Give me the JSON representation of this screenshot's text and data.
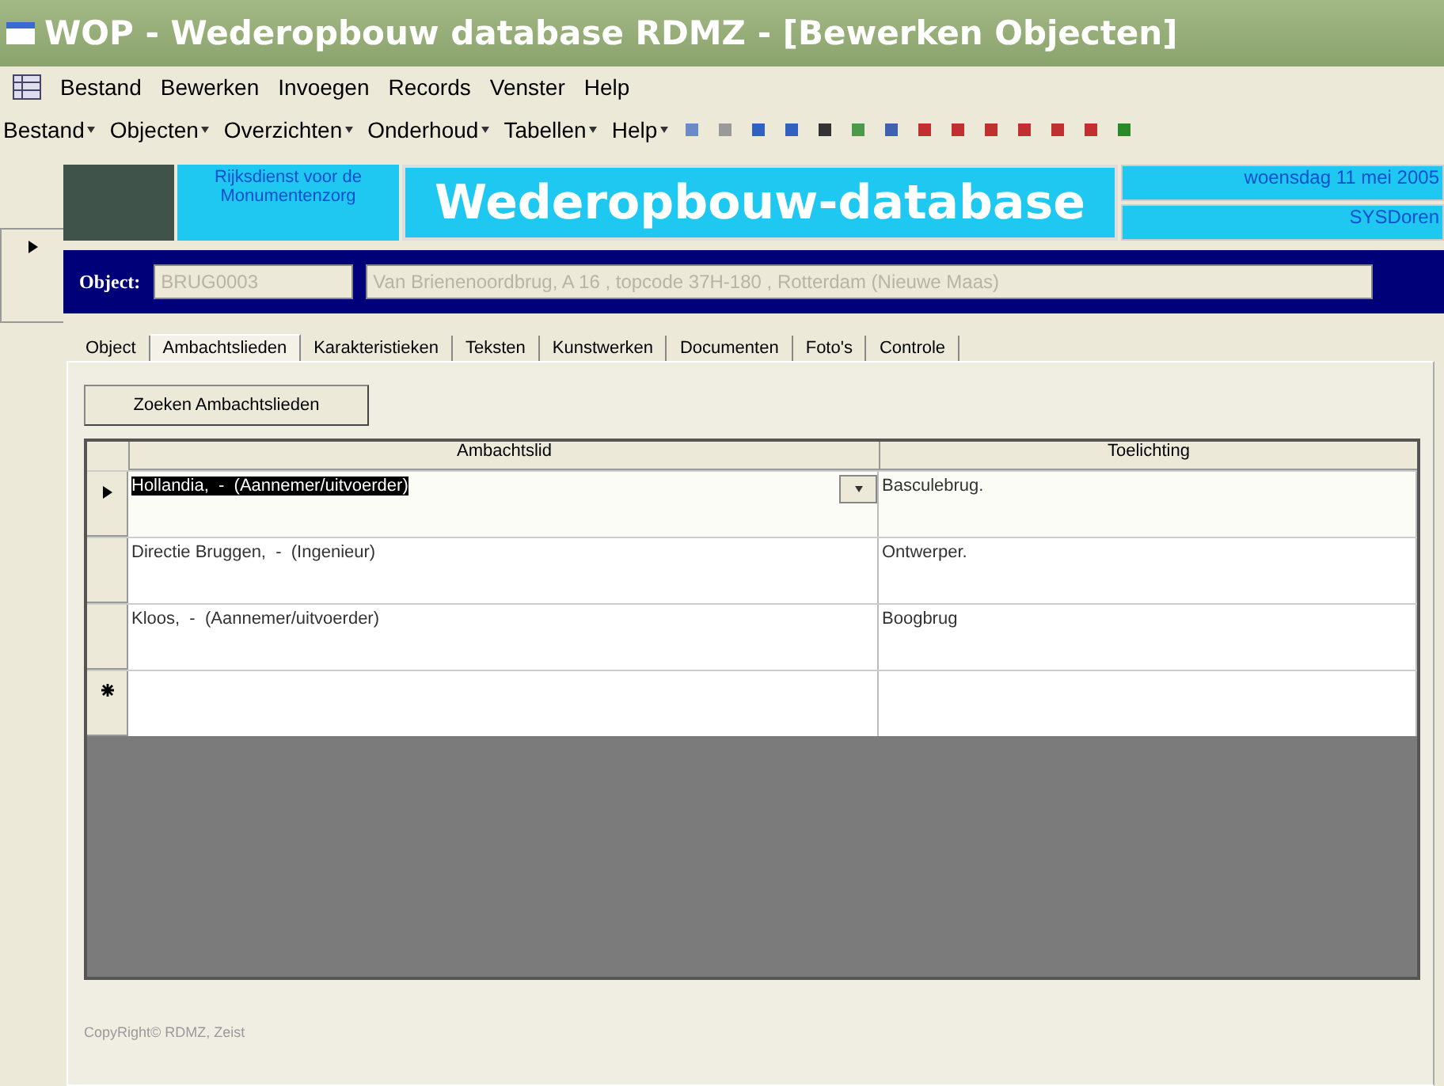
{
  "window": {
    "title": "WOP - Wederopbouw database RDMZ - [Bewerken Objecten]"
  },
  "menu_bar": [
    "Bestand",
    "Bewerken",
    "Invoegen",
    "Records",
    "Venster",
    "Help"
  ],
  "toolbar_menus": [
    "Bestand",
    "Objecten",
    "Overzichten",
    "Onderhoud",
    "Tabellen",
    "Help"
  ],
  "header": {
    "organization": "Rijksdienst voor de Monumentenzorg",
    "title": "Wederopbouw-database",
    "date": "woensdag 11 mei 2005",
    "user": "SYSDoren"
  },
  "object_bar": {
    "label": "Object:",
    "code": "BRUG0003",
    "description": "Van Brienenoordbrug, A 16 , topcode 37H-180 , Rotterdam (Nieuwe Maas)"
  },
  "tabs": [
    {
      "label": "Object",
      "selected": false
    },
    {
      "label": "Ambachtslieden",
      "selected": true
    },
    {
      "label": "Karakteristieken",
      "selected": false
    },
    {
      "label": "Teksten",
      "selected": false
    },
    {
      "label": "Kunstwerken",
      "selected": false
    },
    {
      "label": "Documenten",
      "selected": false
    },
    {
      "label": "Foto's",
      "selected": false
    },
    {
      "label": "Controle",
      "selected": false
    }
  ],
  "search_button": "Zoeken Ambachtslieden",
  "table": {
    "columns": [
      "Ambachtslid",
      "Toelichting"
    ],
    "rows": [
      {
        "kind": "current",
        "selected": true,
        "cells": [
          "Hollandia,  -  (Aannemer/uitvoerder)",
          "Basculebrug."
        ]
      },
      {
        "kind": "plain",
        "selected": false,
        "cells": [
          "Directie Bruggen,  -  (Ingenieur)",
          "Ontwerper."
        ]
      },
      {
        "kind": "plain",
        "selected": false,
        "cells": [
          "Kloos,  -  (Aannemer/uitvoerder)",
          "Boogbrug"
        ]
      },
      {
        "kind": "new",
        "selected": false,
        "cells": [
          "",
          ""
        ]
      }
    ]
  },
  "footer": "CopyRight© RDMZ, Zeist"
}
